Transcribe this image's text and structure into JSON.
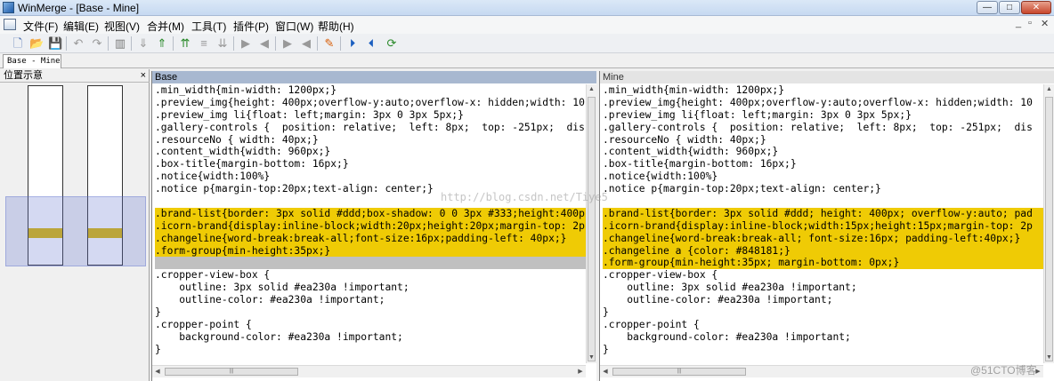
{
  "window": {
    "title": "WinMerge - [Base - Mine]",
    "controls": [
      "—",
      "□",
      "✕"
    ]
  },
  "menu": [
    "文件(F)",
    "编辑(E)",
    "视图(V)",
    "合并(M)",
    "工具(T)",
    "插件(P)",
    "窗口(W)",
    "帮助(H)"
  ],
  "mdi_controls": [
    "_",
    "▫",
    "✕"
  ],
  "toolbar": [
    {
      "icon": "new-file-icon",
      "glyph": "🗋",
      "color": "#4a6fb0"
    },
    {
      "icon": "open-folder-icon",
      "glyph": "📂",
      "color": "#d9a400"
    },
    {
      "icon": "save-icon",
      "glyph": "💾",
      "color": "#888"
    },
    {
      "icon": "undo-icon",
      "glyph": "↶",
      "color": "#999"
    },
    {
      "icon": "redo-icon",
      "glyph": "↷",
      "color": "#999"
    },
    {
      "icon": "options-icon",
      "glyph": "▥",
      "color": "#777"
    },
    {
      "icon": "next-diff-icon",
      "glyph": "⇓",
      "color": "#999"
    },
    {
      "icon": "prev-diff-icon",
      "glyph": "⇑",
      "color": "#2a8a2a"
    },
    {
      "icon": "first-diff-icon",
      "glyph": "⇈",
      "color": "#2a8a2a"
    },
    {
      "icon": "current-diff-icon",
      "glyph": "≡",
      "color": "#999"
    },
    {
      "icon": "last-diff-icon",
      "glyph": "⇊",
      "color": "#999"
    },
    {
      "icon": "copy-right-icon",
      "glyph": "▶",
      "color": "#999"
    },
    {
      "icon": "copy-left-icon",
      "glyph": "◀",
      "color": "#999"
    },
    {
      "icon": "copy-right-advance-icon",
      "glyph": "▶",
      "color": "#999"
    },
    {
      "icon": "copy-left-advance-icon",
      "glyph": "◀",
      "color": "#999"
    },
    {
      "icon": "edit-icon",
      "glyph": "✎",
      "color": "#d85a00"
    },
    {
      "icon": "all-right-icon",
      "glyph": "⏵",
      "color": "#1b5fc0"
    },
    {
      "icon": "all-left-icon",
      "glyph": "⏴",
      "color": "#1b5fc0"
    },
    {
      "icon": "refresh-icon",
      "glyph": "⟳",
      "color": "#2a8a2a"
    }
  ],
  "tabs": [
    "Base - Mine"
  ],
  "location_pane": {
    "title": "位置示意",
    "close": "×"
  },
  "panes": {
    "left": {
      "title": "Base",
      "lines": [
        {
          "t": ".min_width{min-width: 1200px;}",
          "k": "n"
        },
        {
          "t": ".preview_img{height: 400px;overflow-y:auto;overflow-x: hidden;width: 10",
          "k": "n"
        },
        {
          "t": ".preview_img li{float: left;margin: 3px 0 3px 5px;}",
          "k": "n"
        },
        {
          "t": ".gallery-controls {  position: relative;  left: 8px;  top: -251px;  dis",
          "k": "n"
        },
        {
          "t": ".resourceNo { width: 40px;}",
          "k": "n"
        },
        {
          "t": ".content_width{width: 960px;}",
          "k": "n"
        },
        {
          "t": ".box-title{margin-bottom: 16px;}",
          "k": "n"
        },
        {
          "t": ".notice{width:100%}",
          "k": "n"
        },
        {
          "t": ".notice p{margin-top:20px;text-align: center;}",
          "k": "n"
        },
        {
          "t": "",
          "k": "n"
        },
        {
          "t": ".brand-list{border: 3px solid #ddd;box-shadow: 0 0 3px #333;height:400p",
          "k": "d"
        },
        {
          "t": ".icorn-brand{display:inline-block;width:20px;height:20px;margin-top: 2p",
          "k": "d"
        },
        {
          "t": ".changeline{word-break:break-all;font-size:16px;padding-left: 40px;}",
          "k": "d"
        },
        {
          "t": ".form-group{min-height:35px;}",
          "k": "d"
        },
        {
          "t": "",
          "k": "g"
        },
        {
          "t": ".cropper-view-box {",
          "k": "n"
        },
        {
          "t": "    outline: 3px solid #ea230a !important;",
          "k": "n"
        },
        {
          "t": "    outline-color: #ea230a !important;",
          "k": "n"
        },
        {
          "t": "}",
          "k": "n"
        },
        {
          "t": ".cropper-point {",
          "k": "n"
        },
        {
          "t": "    background-color: #ea230a !important;",
          "k": "n"
        },
        {
          "t": "}",
          "k": "n"
        }
      ]
    },
    "right": {
      "title": "Mine",
      "lines": [
        {
          "t": ".min_width{min-width: 1200px;}",
          "k": "n"
        },
        {
          "t": ".preview_img{height: 400px;overflow-y:auto;overflow-x: hidden;width: 10",
          "k": "n"
        },
        {
          "t": ".preview_img li{float: left;margin: 3px 0 3px 5px;}",
          "k": "n"
        },
        {
          "t": ".gallery-controls {  position: relative;  left: 8px;  top: -251px;  dis",
          "k": "n"
        },
        {
          "t": ".resourceNo { width: 40px;}",
          "k": "n"
        },
        {
          "t": ".content_width{width: 960px;}",
          "k": "n"
        },
        {
          "t": ".box-title{margin-bottom: 16px;}",
          "k": "n"
        },
        {
          "t": ".notice{width:100%}",
          "k": "n"
        },
        {
          "t": ".notice p{margin-top:20px;text-align: center;}",
          "k": "n"
        },
        {
          "t": "",
          "k": "n"
        },
        {
          "t": ".brand-list{border: 3px solid #ddd; height: 400px; overflow-y:auto; pad",
          "k": "d"
        },
        {
          "t": ".icorn-brand{display:inline-block;width:15px;height:15px;margin-top: 2p",
          "k": "d"
        },
        {
          "t": ".changeline{word-break:break-all; font-size:16px; padding-left:40px;}",
          "k": "d"
        },
        {
          "t": ".changeline a {color: #848181;}",
          "k": "d"
        },
        {
          "t": ".form-group{min-height:35px; margin-bottom: 0px;}",
          "k": "d"
        },
        {
          "t": ".cropper-view-box {",
          "k": "n"
        },
        {
          "t": "    outline: 3px solid #ea230a !important;",
          "k": "n"
        },
        {
          "t": "    outline-color: #ea230a !important;",
          "k": "n"
        },
        {
          "t": "}",
          "k": "n"
        },
        {
          "t": ".cropper-point {",
          "k": "n"
        },
        {
          "t": "    background-color: #ea230a !important;",
          "k": "n"
        },
        {
          "t": "}",
          "k": "n"
        }
      ]
    }
  },
  "scroll": {
    "thumb_label": "|||"
  },
  "watermarks": {
    "center": "http://blog.csdn.net/Tiye5",
    "corner": "@51CTO博客"
  },
  "colors": {
    "diff": "#efcb05",
    "gap": "#c0c0c0",
    "active_header": "#a8b8d0"
  }
}
